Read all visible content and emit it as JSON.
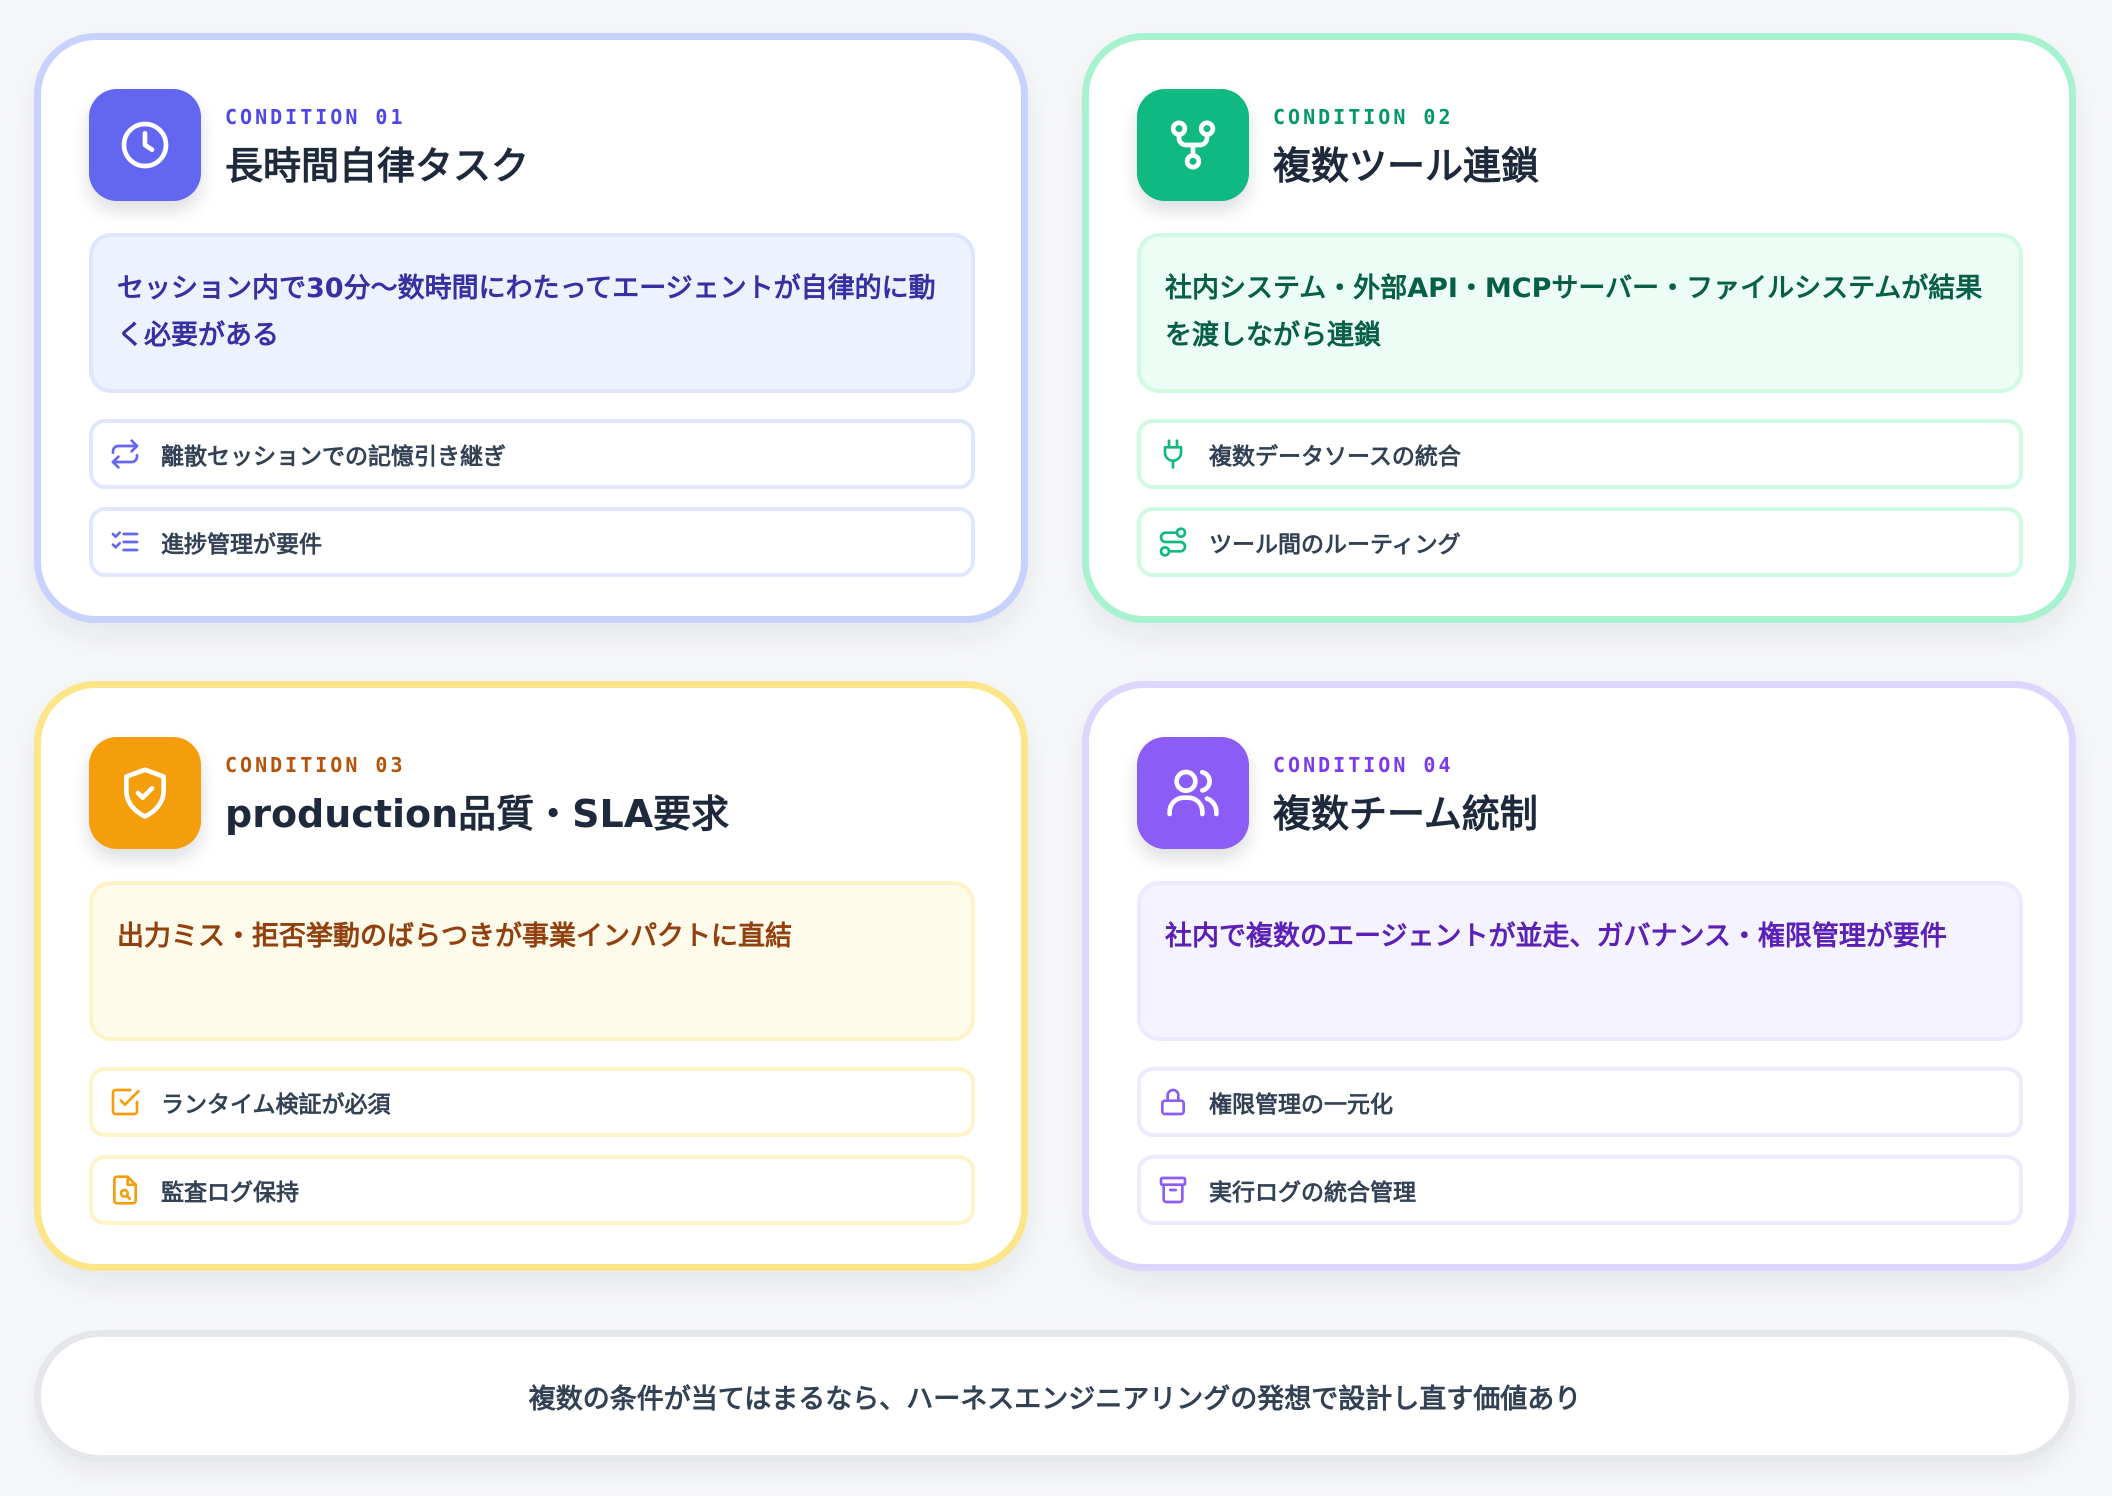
{
  "cards": [
    {
      "kicker": "CONDITION 01",
      "title": "長時間自律タスク",
      "icon": "clock-icon",
      "color": "#6366f1",
      "description": "セッション内で30分〜数時間にわたってエージェントが自律的に動く必要がある",
      "features": [
        {
          "label": "離散セッションでの記憶引き継ぎ",
          "icon": "repeat-icon"
        },
        {
          "label": "進捗管理が要件",
          "icon": "checklist-icon"
        }
      ]
    },
    {
      "kicker": "CONDITION 02",
      "title": "複数ツール連鎖",
      "icon": "git-fork-icon",
      "color": "#10b981",
      "description": "社内システム・外部API・MCPサーバー・ファイルシステムが結果を渡しながら連鎖",
      "features": [
        {
          "label": "複数データソースの統合",
          "icon": "plug-icon"
        },
        {
          "label": "ツール間のルーティング",
          "icon": "route-icon"
        }
      ]
    },
    {
      "kicker": "CONDITION 03",
      "title": "production品質・SLA要求",
      "icon": "shield-check-icon",
      "color": "#f59e0b",
      "description": "出力ミス・拒否挙動のばらつきが事業インパクトに直結",
      "features": [
        {
          "label": "ランタイム検証が必須",
          "icon": "checkbox-icon"
        },
        {
          "label": "監査ログ保持",
          "icon": "file-search-icon"
        }
      ]
    },
    {
      "kicker": "CONDITION 04",
      "title": "複数チーム統制",
      "icon": "users-icon",
      "color": "#8b5cf6",
      "description": "社内で複数のエージェントが並走、ガバナンス・権限管理が要件",
      "features": [
        {
          "label": "権限管理の一元化",
          "icon": "lock-icon"
        },
        {
          "label": "実行ログの統合管理",
          "icon": "archive-icon"
        }
      ]
    }
  ],
  "footer": {
    "text": "複数の条件が当てはまるなら、ハーネスエンジニアリングの発想で設計し直す価値あり"
  }
}
